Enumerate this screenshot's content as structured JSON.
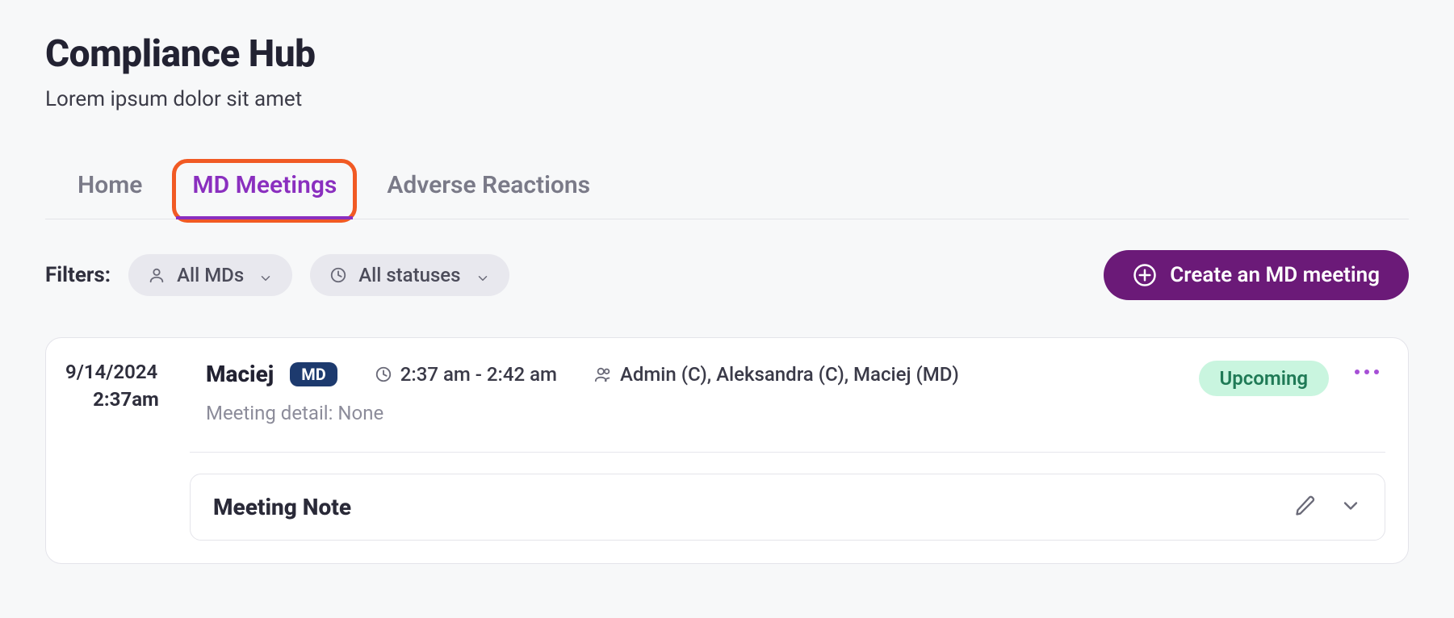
{
  "header": {
    "title": "Compliance Hub",
    "subtitle": "Lorem ipsum dolor sit amet"
  },
  "tabs": [
    {
      "id": "home",
      "label": "Home",
      "active": false
    },
    {
      "id": "md-meetings",
      "label": "MD Meetings",
      "active": true
    },
    {
      "id": "adverse",
      "label": "Adverse Reactions",
      "active": false
    }
  ],
  "filters": {
    "label": "Filters:",
    "md_filter": "All MDs",
    "status_filter": "All statuses"
  },
  "actions": {
    "create_label": "Create an MD meeting"
  },
  "meeting": {
    "date": "9/14/2024",
    "time": "2:37am",
    "name": "Maciej",
    "role_badge": "MD",
    "time_range": "2:37 am - 2:42 am",
    "attendees": "Admin (C), Aleksandra (C), Maciej (MD)",
    "detail_label": "Meeting detail: None",
    "status": "Upcoming",
    "note_section_title": "Meeting Note"
  }
}
